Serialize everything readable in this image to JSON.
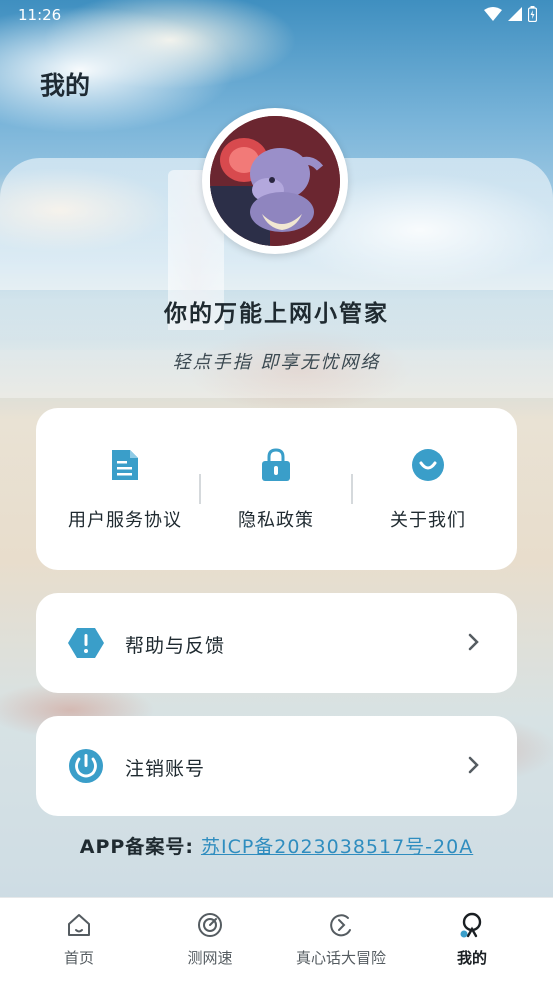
{
  "status_bar": {
    "time": "11:26"
  },
  "page": {
    "title": "我的"
  },
  "profile": {
    "app_name": "你的万能上网小管家",
    "slogan": "轻点手指 即享无忧网络"
  },
  "links": [
    {
      "label": "用户服务协议",
      "icon": "document-icon"
    },
    {
      "label": "隐私政策",
      "icon": "lock-icon"
    },
    {
      "label": "关于我们",
      "icon": "smile-icon"
    }
  ],
  "rows": [
    {
      "label": "帮助与反馈",
      "icon": "alert-hexagon-icon"
    },
    {
      "label": "注销账号",
      "icon": "power-icon"
    }
  ],
  "icp": {
    "label": "APP备案号:",
    "number": "苏ICP备2023038517号-20A"
  },
  "tabs": [
    {
      "label": "首页",
      "icon": "home-icon",
      "active": false
    },
    {
      "label": "测网速",
      "icon": "speed-icon",
      "active": false
    },
    {
      "label": "真心话大冒险",
      "icon": "game-icon",
      "active": false
    },
    {
      "label": "我的",
      "icon": "profile-icon",
      "active": true
    }
  ],
  "colors": {
    "accent": "#3a9ec9",
    "text": "#1f2a30",
    "link": "#2f8dbf"
  }
}
